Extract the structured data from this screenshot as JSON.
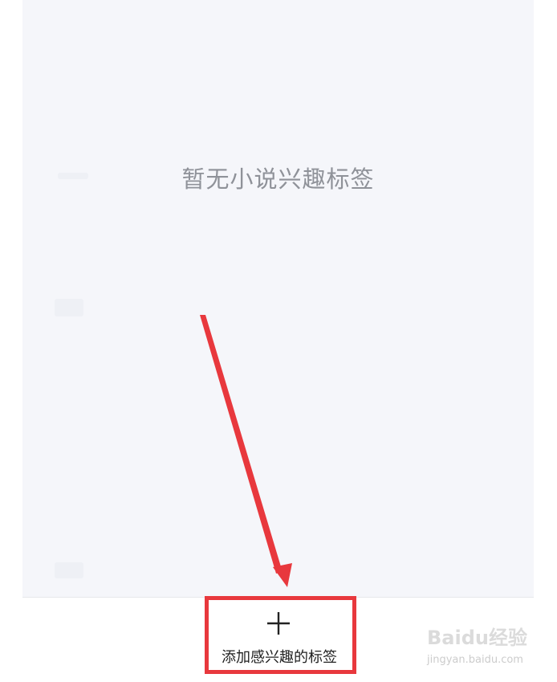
{
  "empty_state": {
    "message": "暂无小说兴趣标签"
  },
  "bottom_bar": {
    "add_tag_label": "添加感兴趣的标签",
    "add_icon": "plus-icon"
  },
  "annotation": {
    "arrow_color": "#e8383d",
    "highlight_color": "#e8383d"
  },
  "watermark": {
    "logo_text": "Baidu经验",
    "url_text": "jingyan.baidu.com"
  }
}
